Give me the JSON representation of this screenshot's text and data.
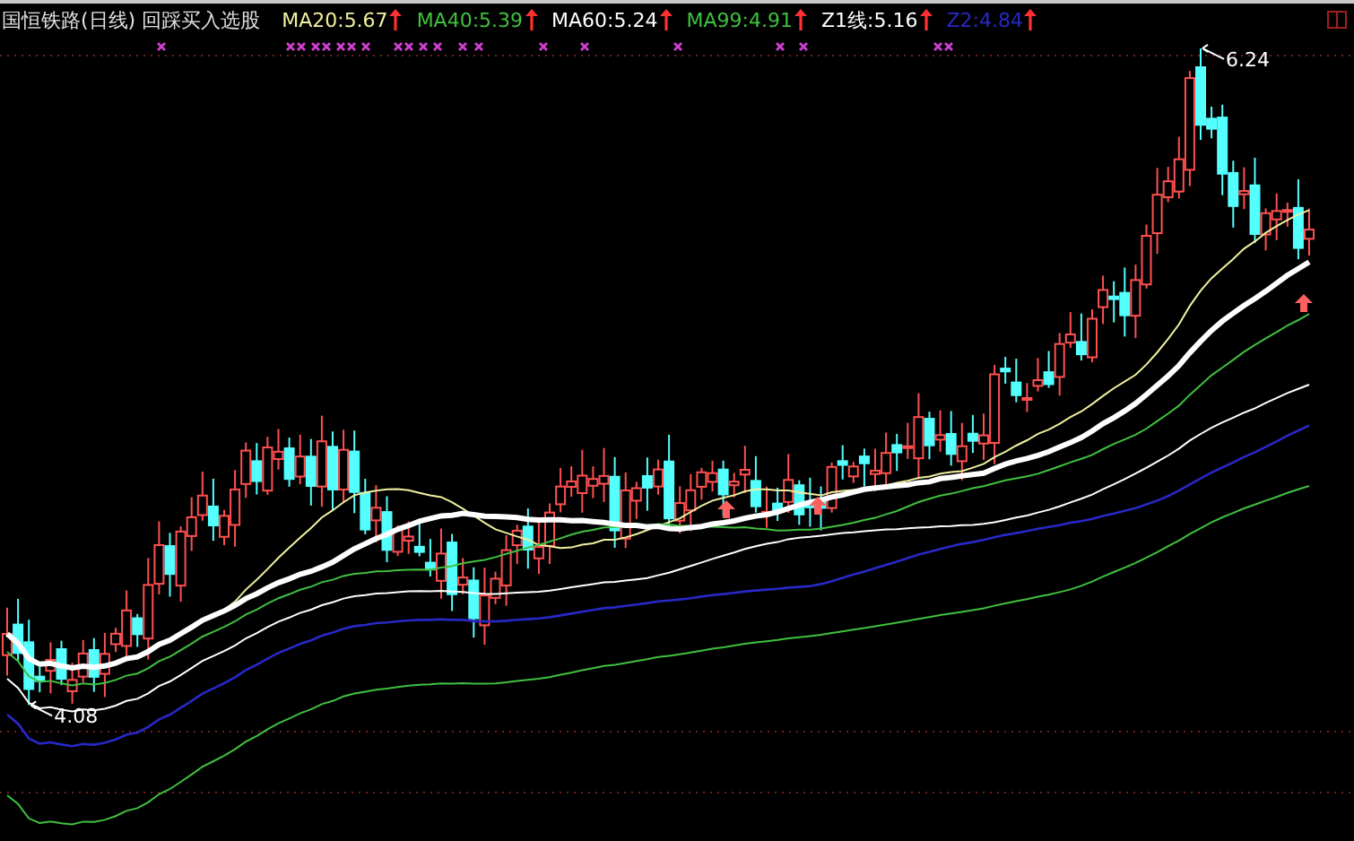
{
  "title": "国恒铁路(日线) 回踩买入选股",
  "indicators": [
    {
      "label": "MA20:5.67",
      "color": "#f0f0a0"
    },
    {
      "label": "MA40:5.39",
      "color": "#40c040"
    },
    {
      "label": "MA60:5.24",
      "color": "#ffffff"
    },
    {
      "label": "MA99:4.91",
      "color": "#40c040"
    },
    {
      "label": "Z1线:5.16",
      "color": "#ffffff"
    },
    {
      "label": "Z2:4.84",
      "color": "#2828c8"
    }
  ],
  "price_labels": [
    {
      "kind": "high",
      "text": "6.24"
    },
    {
      "kind": "low",
      "text": "4.08"
    }
  ]
}
